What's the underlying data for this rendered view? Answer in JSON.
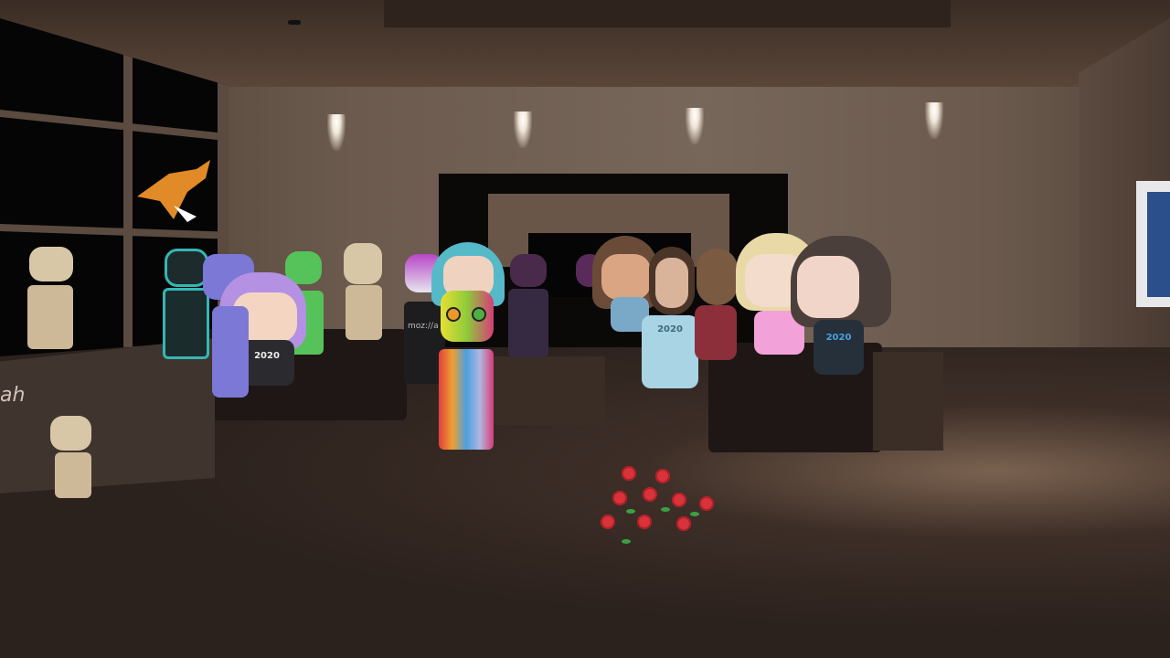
{
  "scene": {
    "panel_label": "ah",
    "robot_screen_text": "moz://a",
    "shirt_texts": [
      "2020",
      "2020",
      "2020",
      "2020"
    ]
  },
  "colors": {
    "wall": "#6b5a4d",
    "floor": "#2b211d",
    "ceiling": "#3a2c24",
    "rose": "#d8333a"
  }
}
